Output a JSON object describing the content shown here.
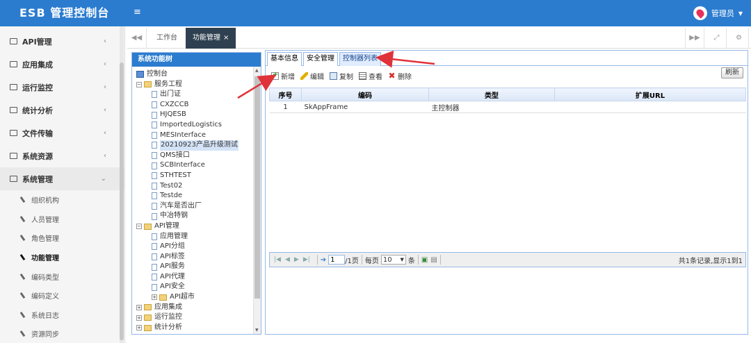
{
  "header": {
    "brand": "ESB 管理控制台",
    "menu_icon": "hamburger-icon",
    "user": "管理员"
  },
  "sidebar": {
    "items": [
      {
        "label": "API管理",
        "open": false
      },
      {
        "label": "应用集成",
        "open": false
      },
      {
        "label": "运行监控",
        "open": false
      },
      {
        "label": "统计分析",
        "open": false
      },
      {
        "label": "文件传输",
        "open": false
      },
      {
        "label": "系统资源",
        "open": false
      },
      {
        "label": "系统管理",
        "open": true
      }
    ],
    "sub_items": [
      {
        "label": "组织机构",
        "active": false
      },
      {
        "label": "人员管理",
        "active": false
      },
      {
        "label": "角色管理",
        "active": false
      },
      {
        "label": "功能管理",
        "active": true
      },
      {
        "label": "编码类型",
        "active": false
      },
      {
        "label": "编码定义",
        "active": false
      },
      {
        "label": "系统日志",
        "active": false
      },
      {
        "label": "资源同步",
        "active": false
      }
    ]
  },
  "tabs": {
    "items": [
      {
        "label": "工作台"
      },
      {
        "label": "功能管理",
        "close": "×"
      }
    ]
  },
  "tree_panel": {
    "title": "系统功能树",
    "nodes": [
      {
        "label": "控制台",
        "level": 0,
        "type": "root"
      },
      {
        "label": "服务工程",
        "level": 1,
        "type": "folder",
        "toggle": "⊟"
      },
      {
        "label": "出门证",
        "level": 2,
        "type": "doc"
      },
      {
        "label": "CXZCCB",
        "level": 2,
        "type": "doc"
      },
      {
        "label": "HJQESB",
        "level": 2,
        "type": "doc"
      },
      {
        "label": "ImportedLogistics",
        "level": 2,
        "type": "doc"
      },
      {
        "label": "MESInterface",
        "level": 2,
        "type": "doc"
      },
      {
        "label": "20210923产品升级测试",
        "level": 2,
        "type": "doc",
        "selected": true
      },
      {
        "label": "QMS接口",
        "level": 2,
        "type": "doc"
      },
      {
        "label": "SCBInterface",
        "level": 2,
        "type": "doc"
      },
      {
        "label": "STHTEST",
        "level": 2,
        "type": "doc"
      },
      {
        "label": "Test02",
        "level": 2,
        "type": "doc"
      },
      {
        "label": "Testde",
        "level": 2,
        "type": "doc"
      },
      {
        "label": "汽车是否出厂",
        "level": 2,
        "type": "doc"
      },
      {
        "label": "中冶特钢",
        "level": 2,
        "type": "doc"
      },
      {
        "label": "API管理",
        "level": 1,
        "type": "folder",
        "toggle": "⊟"
      },
      {
        "label": "应用管理",
        "level": 2,
        "type": "doc"
      },
      {
        "label": "API分组",
        "level": 2,
        "type": "doc"
      },
      {
        "label": "API标签",
        "level": 2,
        "type": "doc"
      },
      {
        "label": "API服务",
        "level": 2,
        "type": "doc"
      },
      {
        "label": "API代理",
        "level": 2,
        "type": "doc"
      },
      {
        "label": "API安全",
        "level": 2,
        "type": "doc"
      },
      {
        "label": "API超市",
        "level": 2,
        "type": "folder",
        "toggle": "⊞"
      },
      {
        "label": "应用集成",
        "level": 1,
        "type": "folder",
        "toggle": "⊞"
      },
      {
        "label": "运行监控",
        "level": 1,
        "type": "folder",
        "toggle": "⊞"
      },
      {
        "label": "统计分析",
        "level": 1,
        "type": "folder",
        "toggle": "⊞"
      }
    ]
  },
  "main_panel": {
    "tabs": [
      {
        "label": "基本信息"
      },
      {
        "label": "安全管理"
      },
      {
        "label": "控制器列表",
        "active": true
      }
    ],
    "toolbar": {
      "add": "新增",
      "edit": "编辑",
      "copy": "复制",
      "view": "查看",
      "delete": "删除",
      "refresh": "刷新"
    },
    "grid": {
      "columns": [
        "序号",
        "编码",
        "类型",
        "扩展URL"
      ],
      "rows": [
        [
          "1",
          "SkAppFrame",
          "主控制器",
          ""
        ]
      ]
    },
    "pager": {
      "page_input": "1",
      "page_total": "/1页",
      "per_page_label": "每页",
      "per_page_value": "10",
      "per_page_unit": "条",
      "info": "共1条记录,显示1到1"
    }
  },
  "colors": {
    "header": "#2b7ccf",
    "annotation": "#e0323a",
    "active_tab": "#2f4050"
  }
}
